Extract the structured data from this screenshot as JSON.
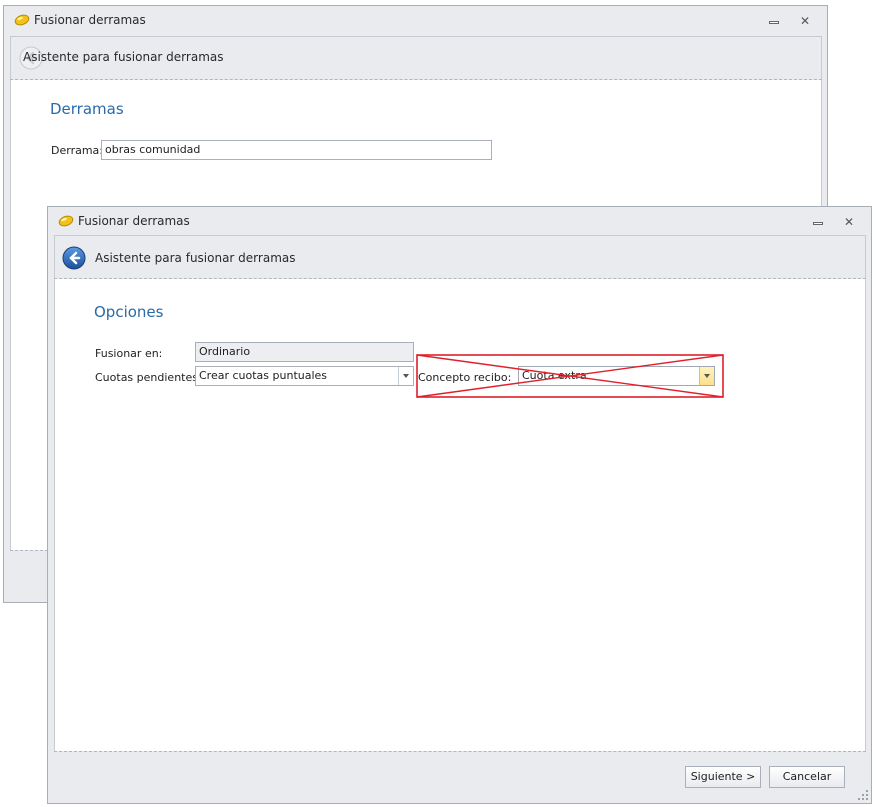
{
  "back_window": {
    "title": "Fusionar derramas",
    "header": "Asistente para fusionar derramas",
    "section_title": "Derramas",
    "derrama_label": "Derrama:",
    "derrama_value": "obras comunidad"
  },
  "front_window": {
    "title": "Fusionar derramas",
    "header": "Asistente para fusionar derramas",
    "section_title": "Opciones",
    "fusionar_label": "Fusionar en:",
    "fusionar_value": "Ordinario",
    "cuotas_label": "Cuotas pendientes:",
    "cuotas_value": "Crear cuotas puntuales",
    "concepto_label": "Concepto recibo:",
    "concepto_value": "Cuota extra",
    "next_button": "Siguiente >",
    "cancel_button": "Cancelar"
  },
  "icons": {
    "app": "yellow-pill-icon",
    "back": "back-arrow-icon",
    "minimize": "minimize-icon",
    "close": "close-icon",
    "resize": "resize-grip-icon"
  },
  "colors": {
    "accent_title": "#2b6aa6",
    "annotation": "#e0202a",
    "chrome": "#e9ebee"
  }
}
